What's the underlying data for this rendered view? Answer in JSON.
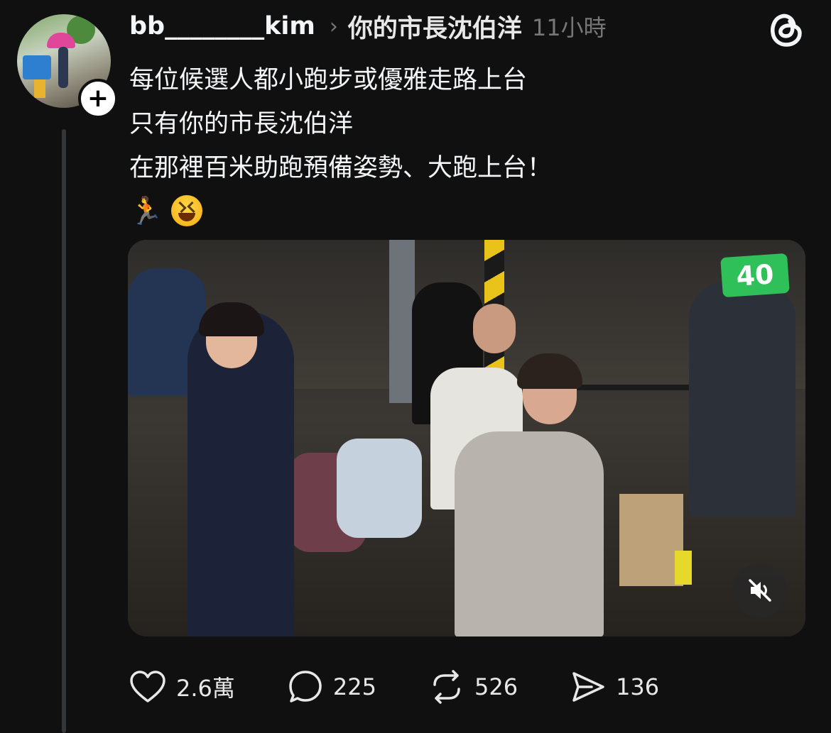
{
  "post": {
    "username": "bb________kim",
    "topic": "你的市長沈伯洋",
    "time": "11小時",
    "lines": [
      "每位候選人都小跑步或優雅走路上台",
      "只有你的市長沈伯洋",
      "在那裡百米助跑預備姿勢、大跑上台！"
    ],
    "emojis": [
      "🏃",
      "😆"
    ],
    "video_badge": "40"
  },
  "actions": {
    "likes": "2.6萬",
    "comments": "225",
    "reposts": "526",
    "shares": "136"
  },
  "icons": {
    "logo": "threads-logo-icon",
    "follow": "plus-icon",
    "mute": "speaker-muted-icon",
    "like": "heart-icon",
    "comment": "speech-bubble-icon",
    "repost": "repost-icon",
    "share": "paper-plane-icon"
  },
  "colors": {
    "background": "#101010",
    "text": "#f3f5f7",
    "muted": "#777777",
    "thread_line": "#333638"
  }
}
